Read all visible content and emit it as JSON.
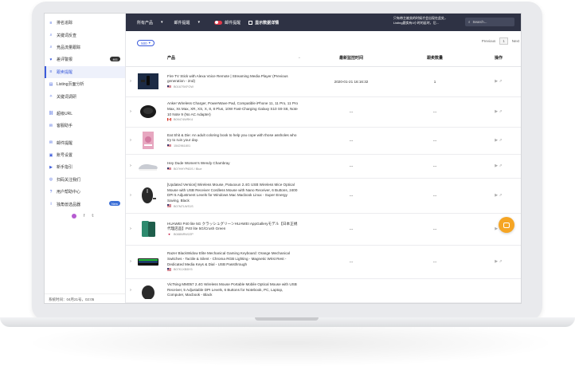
{
  "sidebar": {
    "items": [
      {
        "icon": "list-icon",
        "label": "排名追踪"
      },
      {
        "icon": "search-icon",
        "label": "关键词反查",
        "sub": "排名"
      },
      {
        "icon": "search-icon",
        "label": "竞品流量跟踪"
      },
      {
        "icon": "heart-icon",
        "label": "差评警报",
        "badge": "461"
      },
      {
        "icon": "list-icon",
        "label": "跟卖提醒",
        "active": true
      },
      {
        "icon": "chart-icon",
        "label": "Listing页面分析"
      },
      {
        "icon": "magic-icon",
        "label": "关键词调研"
      },
      {
        "icon": "link-icon",
        "label": "超级URL"
      },
      {
        "icon": "message-icon",
        "label": "客服助手"
      },
      {
        "icon": "mail-icon",
        "label": "邮件提醒"
      },
      {
        "icon": "user-icon",
        "label": "账号设置"
      },
      {
        "icon": "video-icon",
        "label": "新手指引"
      },
      {
        "icon": "wechat-icon",
        "label": "扫码关注我们"
      },
      {
        "icon": "help-icon",
        "label": "用户帮助中心"
      },
      {
        "icon": "info-icon",
        "label": "独角兽选品器",
        "badge": "New"
      }
    ],
    "footer": "系统时间：04月21号，02:05"
  },
  "topbar": {
    "product_select": "所有产品",
    "mail_select": "邮件提醒",
    "mail_toggle_label": "邮件提醒",
    "show_data_label": "显示数据详情",
    "note_line1": "只有带主被卖的时候才会出现在此处，",
    "note_line2": "Listing跟卖有4小时的延时，后...",
    "search_placeholder": "Search..."
  },
  "controls": {
    "per_page": "500",
    "pager_prev": "Previous",
    "pager_current": "1",
    "pager_next": "Next"
  },
  "table": {
    "headers": {
      "product": "产品",
      "time": "最新监控时间",
      "count": "跟卖数量",
      "action": "操作"
    },
    "rows": [
      {
        "title": "Fire TV Stick with Alexa Voice Remote | Streaming Media Player (Previous generation - 2nd)",
        "flag": "us",
        "asin": "B0167SKFOW",
        "time": "2020-01-21 16:16:32",
        "count": "1",
        "thumb": "firetv"
      },
      {
        "title": "Anker Wireless Charger, PowerWave Pad, Compatible iPhone 11, 11 Pro, 11 Pro Max, Xs Max, XR, XS, X, 8, 8 Plus, 10W Fast-Charging Galaxy S10 S9 S8, Note 10 Note 9 (No AC Adapter)",
        "flag": "ca",
        "asin": "B09474WRK4",
        "time": "---",
        "count": "---",
        "thumb": "charger"
      },
      {
        "title": "Eat Shit & Die: An adult coloring book to help you cope with those assholes who try to ruin your day.",
        "flag": "us",
        "asin": "1542961801",
        "time": "---",
        "count": "---",
        "thumb": "book"
      },
      {
        "title": "Hey Dude Women's Wendy Chambray",
        "flag": "us",
        "asin": "B07HHYP6DS / Blue",
        "time": "---",
        "count": "---",
        "thumb": "shoe"
      },
      {
        "title": "[Updated Version] Wireless Mouse, Patuoxun 2.4G USB Wireless Mice Optical Mouse with USB Receiver Cordless Mouse with Nano Receiver, 6 Buttons, 2400 DPI 5 Adjustment Levels for Windows Mac Macbook Linux - Super Energy Saving, Black",
        "flag": "us",
        "asin": "B07M7LWS1S",
        "time": "---",
        "count": "---",
        "thumb": "mouse"
      },
      {
        "title": "HUAWEI P40 lite 5G クラッシュグリーンHUAWEI AppGalleryモデル【日本正規代理店品】P40 lite 5G/Crush Green",
        "flag": "jp",
        "asin": "B088NRW2ZP",
        "time": "---",
        "count": "---",
        "thumb": "phone"
      },
      {
        "title": "Razer BlackWidow Elite Mechanical Gaming Keyboard: Orange Mechanical Switches - Tactile & Silent - Chroma RGB Lighting - Magnetic Wrist Rest - Dedicated Media Keys & Dial - USB Passthrough",
        "flag": "us",
        "asin": "B07K1XBBY5",
        "time": "---",
        "count": "---",
        "thumb": "keyboard"
      },
      {
        "title": "VicTsing MM057 2.4G Wireless Mouse Portable Mobile Optical Mouse with USB Receiver, 5 Adjustable DPI Levels, 6 Buttons for Notebook, PC, Laptop, Computer, Macbook - Black",
        "flag": "us",
        "asin": "",
        "time": "",
        "count": "",
        "thumb": "mouse2"
      }
    ]
  },
  "colors": {
    "topbar": "#2e3244",
    "accent": "#3b5bdb",
    "toggle": "#e23a4a",
    "chat": "#f5a524"
  }
}
